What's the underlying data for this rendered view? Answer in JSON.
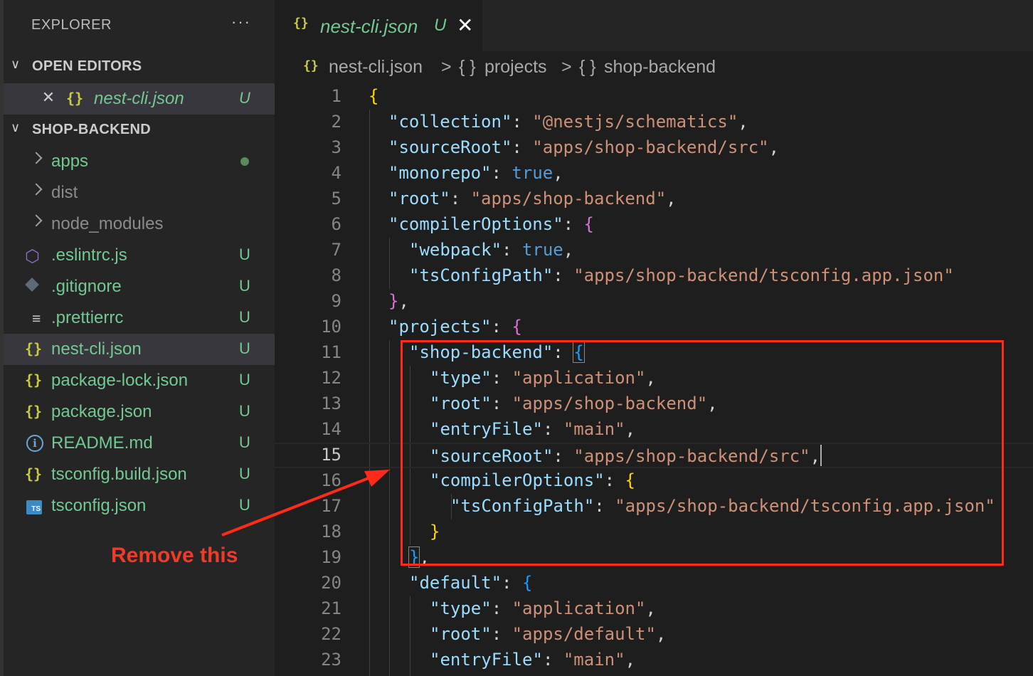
{
  "sidebar": {
    "title": "EXPLORER",
    "more": "···",
    "open_editors": {
      "label": "OPEN EDITORS",
      "items": [
        {
          "close": "✕",
          "icon": "{}",
          "name": "nest-cli.json",
          "status": "U"
        }
      ]
    },
    "project": {
      "label": "SHOP-BACKEND",
      "folders": [
        {
          "name": "apps",
          "modified": true
        },
        {
          "name": "dist"
        },
        {
          "name": "node_modules"
        }
      ],
      "files": [
        {
          "name": ".eslintrc.js",
          "icon": "eslint-icon",
          "status": "U"
        },
        {
          "name": ".gitignore",
          "icon": "git-icon",
          "status": "U"
        },
        {
          "name": ".prettierrc",
          "icon": "lines-icon",
          "status": "U"
        },
        {
          "name": "nest-cli.json",
          "icon": "{}",
          "status": "U"
        },
        {
          "name": "package-lock.json",
          "icon": "{}",
          "status": "U"
        },
        {
          "name": "package.json",
          "icon": "{}",
          "status": "U"
        },
        {
          "name": "README.md",
          "icon": "i",
          "status": "U"
        },
        {
          "name": "tsconfig.build.json",
          "icon": "{}",
          "status": "U"
        },
        {
          "name": "tsconfig.json",
          "icon": "TS",
          "status": "U"
        }
      ]
    }
  },
  "editor": {
    "tab": {
      "icon": "{}",
      "label": "nest-cli.json",
      "status": "U",
      "close": "✕"
    },
    "breadcrumb": [
      "nest-cli.json",
      "projects",
      "shop-backend"
    ],
    "breadcrumb_icon": "{}",
    "breadcrumb_sep": ">",
    "line_numbers": [
      "1",
      "2",
      "3",
      "4",
      "5",
      "6",
      "7",
      "8",
      "9",
      "10",
      "11",
      "12",
      "13",
      "14",
      "15",
      "16",
      "17",
      "18",
      "19",
      "20",
      "21",
      "22",
      "23"
    ],
    "current_line": 15
  },
  "annotation": {
    "text": "Remove this"
  },
  "colors": {
    "highlight": "#ff2a1a",
    "untracked": "#73c991"
  }
}
